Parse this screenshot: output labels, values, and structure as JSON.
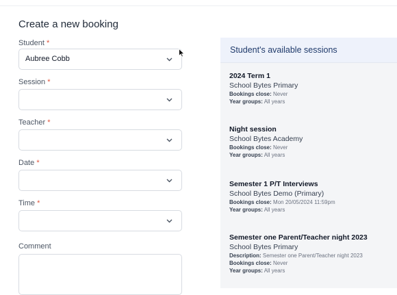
{
  "page": {
    "title": "Create a new booking"
  },
  "form": {
    "student": {
      "label": "Student",
      "required": "*",
      "value": "Aubree Cobb"
    },
    "session": {
      "label": "Session",
      "required": "*",
      "value": ""
    },
    "teacher": {
      "label": "Teacher",
      "required": "*",
      "value": ""
    },
    "date": {
      "label": "Date",
      "required": "*",
      "value": ""
    },
    "time": {
      "label": "Time",
      "required": "*",
      "value": ""
    },
    "comment": {
      "label": "Comment",
      "value": ""
    }
  },
  "panel": {
    "title": "Student's available sessions",
    "sessions": [
      {
        "name": "2024 Term 1",
        "school": "School Bytes Primary",
        "bookings_close_label": "Bookings close:",
        "bookings_close": "Never",
        "year_groups_label": "Year groups:",
        "year_groups": "All years"
      },
      {
        "name": "Night session",
        "school": "School Bytes Academy",
        "bookings_close_label": "Bookings close:",
        "bookings_close": "Never",
        "year_groups_label": "Year groups:",
        "year_groups": "All years"
      },
      {
        "name": "Semester 1 P/T Interviews",
        "school": "School Bytes Demo (Primary)",
        "bookings_close_label": "Bookings close:",
        "bookings_close": "Mon 20/05/2024 11:59pm",
        "year_groups_label": "Year groups:",
        "year_groups": "All years"
      },
      {
        "name": "Semester one Parent/Teacher night 2023",
        "school": "School Bytes Primary",
        "description_label": "Description:",
        "description": "Semester one Parent/Teacher night 2023",
        "bookings_close_label": "Bookings close:",
        "bookings_close": "Never",
        "year_groups_label": "Year groups:",
        "year_groups": "All years"
      }
    ]
  },
  "icons": {
    "dropdown": "chevron-down-icon",
    "pointer": "mouse-cursor-icon"
  },
  "colors": {
    "required": "#e0553d",
    "panel_header_bg": "#eef2fb",
    "panel_header_text": "#1f3a6b",
    "panel_bg": "#f4f5f7"
  }
}
